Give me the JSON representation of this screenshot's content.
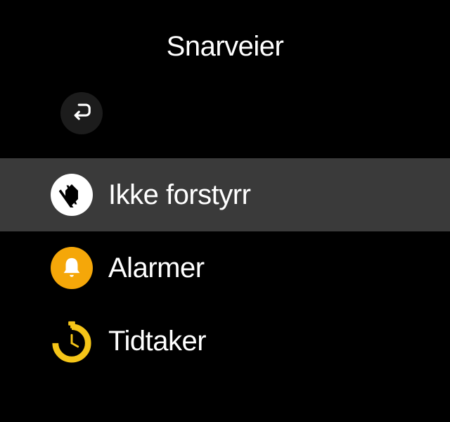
{
  "header": {
    "title": "Snarveier"
  },
  "controls": {
    "back": "back"
  },
  "items": [
    {
      "icon": "dnd",
      "label": "Ikke forstyrr",
      "selected": true
    },
    {
      "icon": "alarm",
      "label": "Alarmer",
      "selected": false
    },
    {
      "icon": "timer",
      "label": "Tidtaker",
      "selected": false
    }
  ],
  "colors": {
    "background": "#000000",
    "selected": "#3a3a3a",
    "iconWhite": "#ffffff",
    "iconAmber": "#f5a709",
    "text": "#ffffff"
  }
}
